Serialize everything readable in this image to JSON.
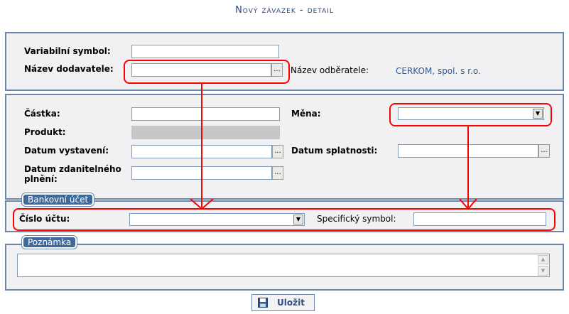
{
  "page": {
    "title": "Nový závazek - detail"
  },
  "supplier_section": {
    "variable_symbol_label": "Variabilní symbol:",
    "variable_symbol_value": "",
    "supplier_name_label": "Název dodavatele:",
    "supplier_name_value": "",
    "lookup_label": "...",
    "customer_name_label": "Název odběratele:",
    "customer_name_value": "CERKOM, spol. s r.o."
  },
  "amount_section": {
    "amount_label": "Částka:",
    "amount_value": "",
    "currency_label": "Měna:",
    "currency_selected": "",
    "product_label": "Produkt:",
    "product_value": "",
    "issue_date_label": "Datum vystavení:",
    "issue_date_value": "",
    "due_date_label": "Datum splatnosti:",
    "due_date_value": "",
    "taxable_date_label_line1": "Datum zdanitelného",
    "taxable_date_label_line2": "plnění:",
    "taxable_date_value": "",
    "lookup_label": "..."
  },
  "bank_section": {
    "legend": "Bankovní účet",
    "account_number_label": "Číslo účtu:",
    "account_number_selected": "",
    "specific_symbol_label": "Specifický symbol:",
    "specific_symbol_value": ""
  },
  "note_section": {
    "legend": "Poznámka",
    "note_value": ""
  },
  "actions": {
    "save_label": "Uložit"
  },
  "icons": {
    "save": "floppy-disk-icon",
    "select_arrow": "triangle-down-icon",
    "scroll_up": "triangle-up-icon",
    "scroll_down": "triangle-down-icon"
  },
  "colors": {
    "title": "#24457a",
    "panel_border": "#6d87a8",
    "panel_bg": "#f1f1f4",
    "legend_bg": "#3d6a9d",
    "annotation": "#ff0000",
    "link_value": "#2e5b96"
  }
}
